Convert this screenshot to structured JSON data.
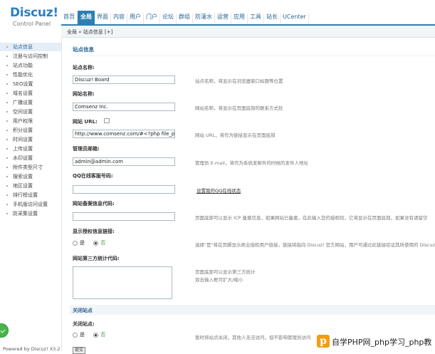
{
  "brand": {
    "logo": "Discuz!",
    "subtitle": "Control Panel"
  },
  "topnav": [
    "首页",
    "全局",
    "界面",
    "内容",
    "用户",
    "门户",
    "论坛",
    "群组",
    "防灌水",
    "运营",
    "应用",
    "工具",
    "站长",
    "UCenter"
  ],
  "topnav_active_index": 1,
  "breadcrumb": "全局 » 站点信息  [+]",
  "sidebar": {
    "items": [
      "站点信息",
      "注册与访问控制",
      "站点功能",
      "性能优化",
      "SEO设置",
      "域名设置",
      "广播设置",
      "空间设置",
      "用户权限",
      "积分设置",
      "时间设置",
      "上传设置",
      "水印设置",
      "附件类型尺寸",
      "搜索设置",
      "地区设置",
      "排行榜设置",
      "手机版访问设置",
      "防采集设置"
    ],
    "active_index": 0,
    "powered": "Powered by Discuz! X3.2"
  },
  "main": {
    "section_title": "站点信息",
    "fields": {
      "site_name": {
        "label": "站点名称:",
        "value": "Discuz! Board",
        "tip": "站点名称，将显示在浏览器窗口标题等位置"
      },
      "web_name": {
        "label": "网站名称:",
        "value": "Comsenz Inc.",
        "tip": "网站名称，将显示在页面底部的联系方式处"
      },
      "web_url": {
        "label": "网站 URL:",
        "value": "http://www.comsenz.com/#<?php file_p",
        "tip": "网站 URL，将作为链接显示在页面底部"
      },
      "admin_email": {
        "label": "管理员邮箱:",
        "value": "admin@admin.com",
        "tip": "管理员 E-mail，将作为系统发邮件的时候的发件人地址"
      },
      "qq": {
        "label": "QQ在线客服号码:",
        "value": "",
        "tip": "设置我的QQ在线状态"
      },
      "icp": {
        "label": "网站备案信息代码:",
        "value": "",
        "tip": "页面底部可以显示 ICP 备案信息，如果网站已备案，在此输入您的授权码，它将显示在页面底部，如果没有请留空"
      },
      "license": {
        "label": "显示授权信息链接:",
        "yes": "是",
        "no": "否",
        "tip": "选择\"是\"将在页脚显示商业授权用户链接，链接将指向 Discuz! 官方网站，用户可通过此链接验证其所使用的 Discuz!"
      },
      "stats": {
        "label": "网站第三方统计代码:",
        "tip1": "页面底部可以显示第三方统计",
        "tip2": "双击输入框可扩大/缩小"
      }
    },
    "close_section": {
      "title": "关闭站点",
      "label": "关闭站点:",
      "yes": "是",
      "no": "否",
      "tip": "暂时将站点关闭，其他人无法访问，但不影响管理员访问"
    },
    "submit": "提交"
  },
  "watermark": {
    "icon": "p",
    "text": "自学PHP网_php学习_php教"
  },
  "colors": {
    "accent": "#2d7fb3",
    "link": "#2a6496",
    "green": "#4bb34a",
    "watermark": "#f39c12"
  }
}
